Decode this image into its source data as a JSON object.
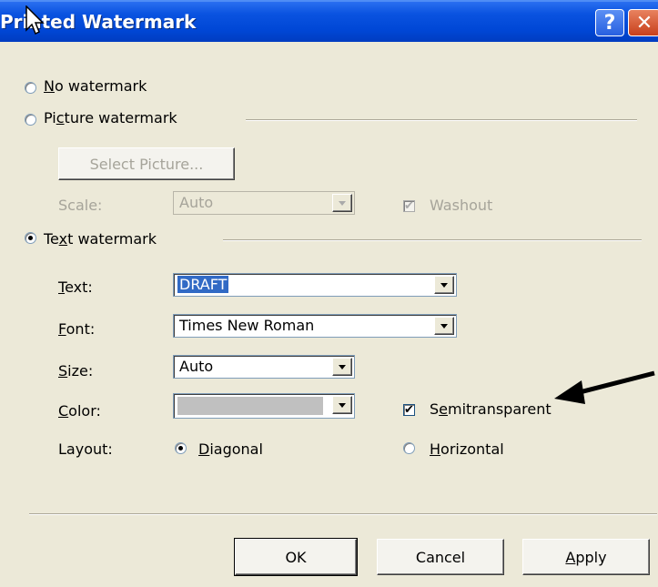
{
  "window": {
    "title": "Printed Watermark",
    "help_label": "?",
    "close_label": "✕"
  },
  "options": {
    "no_watermark": {
      "pre": "",
      "u": "N",
      "post": "o watermark"
    },
    "picture_watermark": {
      "pre": "Pi",
      "u": "c",
      "post": "ture watermark"
    },
    "text_watermark": {
      "pre": "Te",
      "u": "x",
      "post": "t watermark"
    },
    "selected": "text"
  },
  "picture": {
    "select_button": "Select Picture...",
    "scale_label": "Scale:",
    "scale_value": "Auto",
    "washout_label": "Washout",
    "washout_checked": true
  },
  "text_settings": {
    "text_label": {
      "u": "T",
      "post": "ext:"
    },
    "text_value": "DRAFT",
    "font_label": {
      "u": "F",
      "post": "ont:"
    },
    "font_value": "Times New Roman",
    "size_label": {
      "u": "S",
      "post": "ize:"
    },
    "size_value": "Auto",
    "color_label": {
      "u": "C",
      "post": "olor:"
    },
    "color_value": "#c0c0c0",
    "semitransparent": {
      "pre": "S",
      "u": "e",
      "post": "mitransparent"
    },
    "semitransparent_checked": true,
    "layout_label": "Layout:",
    "diagonal": {
      "u": "D",
      "post": "iagonal"
    },
    "horizontal": {
      "u": "H",
      "post": "orizontal"
    },
    "layout_selected": "diagonal"
  },
  "buttons": {
    "ok": "OK",
    "cancel": "Cancel",
    "apply": {
      "u": "A",
      "post": "pply"
    }
  },
  "colors": {
    "titlebar": "#0047d6",
    "dialog_bg": "#ece9d8",
    "selection": "#316ac5"
  }
}
